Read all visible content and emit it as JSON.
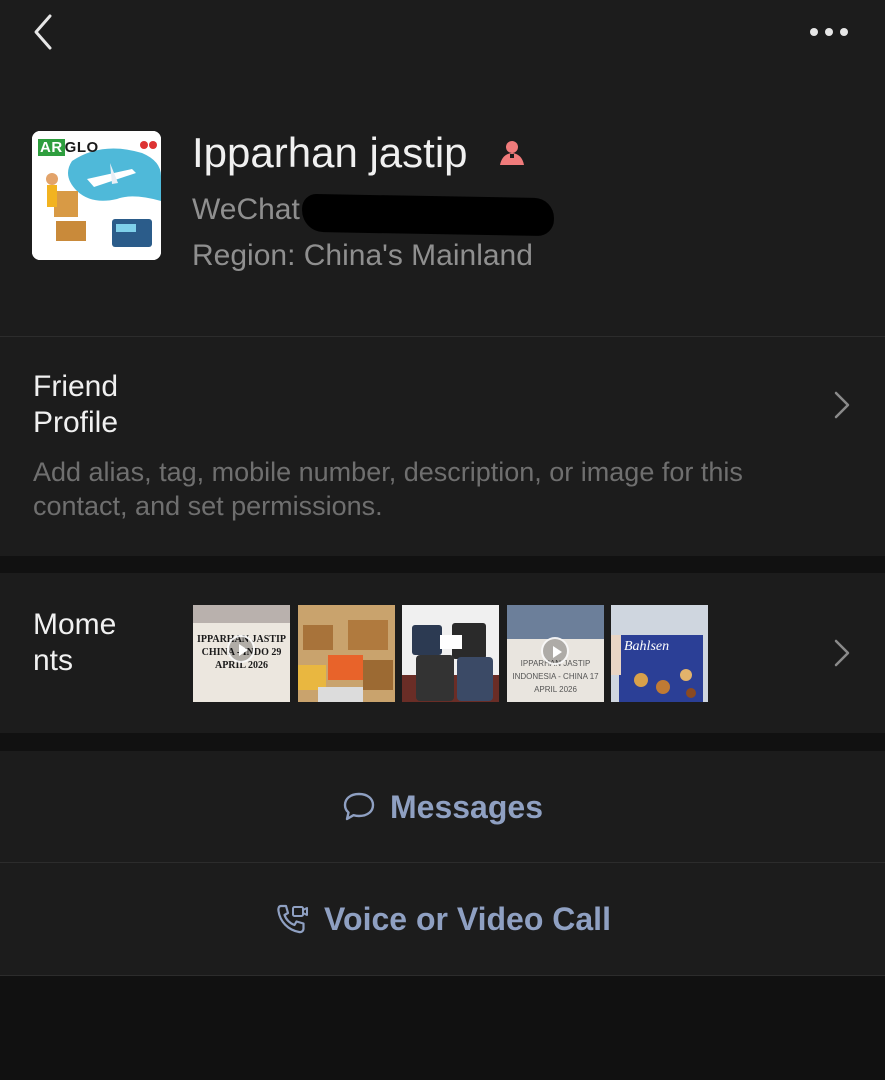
{
  "header": {
    "back_icon": "chevron-left-icon",
    "more_icon": "more-dots-icon"
  },
  "profile": {
    "avatar_brand_ar": "AR",
    "avatar_brand_rest": "GLO",
    "name": "Ipparhan jastip",
    "gender_icon": "female-icon",
    "wechat_id_label": "WeChat I",
    "region": "Region: China's Mainland"
  },
  "friend_profile": {
    "title_line1": "Friend",
    "title_line2": "Profile",
    "description": "Add alias, tag, mobile number, description, or image for this contact, and set permissions."
  },
  "moments": {
    "title_line1": "Mome",
    "title_line2": "nts",
    "thumbnails": [
      {
        "caption": "IPPARHAN JASTIP CHINA - INDO 29 APRIL 2026",
        "video": true
      },
      {
        "caption": "",
        "video": false
      },
      {
        "caption": "",
        "video": false
      },
      {
        "caption": "IPPARHAN JASTIP INDONESIA - CHINA 17 APRIL 2026",
        "video": true
      },
      {
        "caption": "Bahlsen",
        "video": false
      }
    ]
  },
  "actions": {
    "messages_label": "Messages",
    "messages_icon": "chat-bubble-icon",
    "call_label": "Voice or Video Call",
    "call_icon": "phone-video-icon"
  },
  "colors": {
    "background": "#111111",
    "card": "#1c1c1c",
    "accent_link": "#8fa0c2",
    "gender_pink": "#f07b7b"
  }
}
